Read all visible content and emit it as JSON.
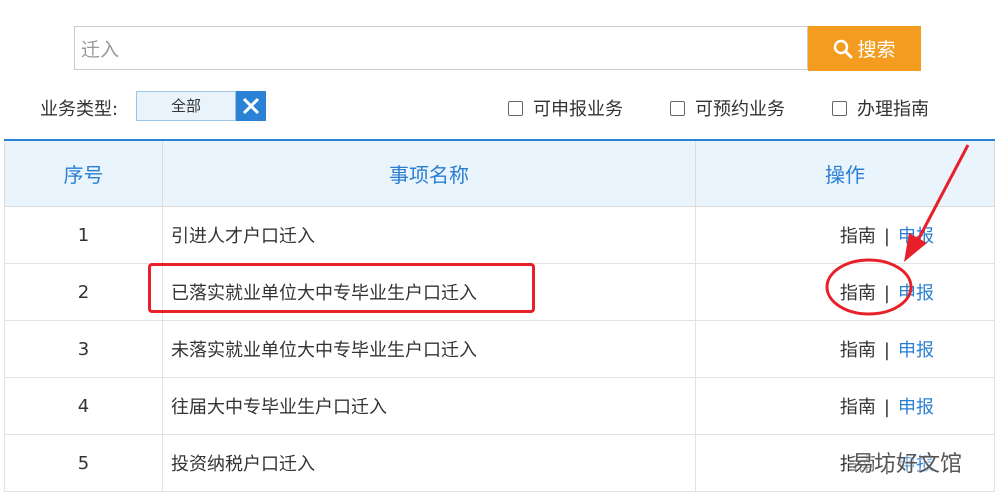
{
  "search": {
    "value": "迁入",
    "button_label": "搜索"
  },
  "filter": {
    "label": "业务类型:",
    "selected": "全部",
    "checkboxes": [
      "可申报业务",
      "可预约业务",
      "办理指南"
    ]
  },
  "table": {
    "headers": [
      "序号",
      "事项名称",
      "操作"
    ],
    "rows": [
      {
        "num": "1",
        "name": "引进人才户口迁入",
        "guide": "指南",
        "sep": "|",
        "apply": "申报"
      },
      {
        "num": "2",
        "name": "已落实就业单位大中专毕业生户口迁入",
        "guide": "指南",
        "sep": "|",
        "apply": "申报"
      },
      {
        "num": "3",
        "name": "未落实就业单位大中专毕业生户口迁入",
        "guide": "指南",
        "sep": "|",
        "apply": "申报"
      },
      {
        "num": "4",
        "name": "往届大中专毕业生户口迁入",
        "guide": "指南",
        "sep": "|",
        "apply": "申报"
      },
      {
        "num": "5",
        "name": "投资纳税户口迁入",
        "guide": "指南",
        "sep": "|",
        "apply": "申报"
      }
    ]
  },
  "watermark": "易坊好文馆",
  "colors": {
    "accent": "#f39c1f",
    "link": "#2a7fd2",
    "annotation": "#e8202a"
  }
}
